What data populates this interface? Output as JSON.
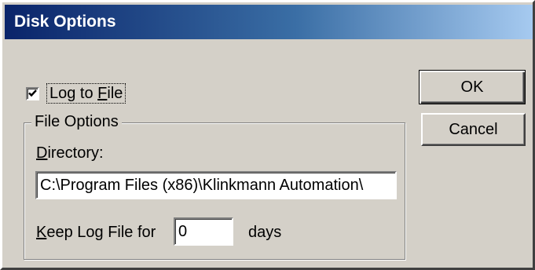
{
  "window": {
    "title": "Disk Options"
  },
  "log_to_file": {
    "checked": true,
    "label_pre": "Log to ",
    "label_access": "F",
    "label_post": "ile"
  },
  "file_options": {
    "group_label": "File Options",
    "directory": {
      "label_access": "D",
      "label_rest": "irectory:",
      "value": "C:\\Program Files (x86)\\Klinkmann Automation\\"
    },
    "keep": {
      "label_access": "K",
      "label_rest": "eep Log File for",
      "value": "0",
      "unit": "days"
    }
  },
  "buttons": {
    "ok": "OK",
    "cancel": "Cancel"
  },
  "colors": {
    "face": "#d4d0c8",
    "title_start": "#0a246a",
    "title_end": "#a6caf0"
  },
  "icons": {
    "checkbox_mark": "check-icon"
  }
}
